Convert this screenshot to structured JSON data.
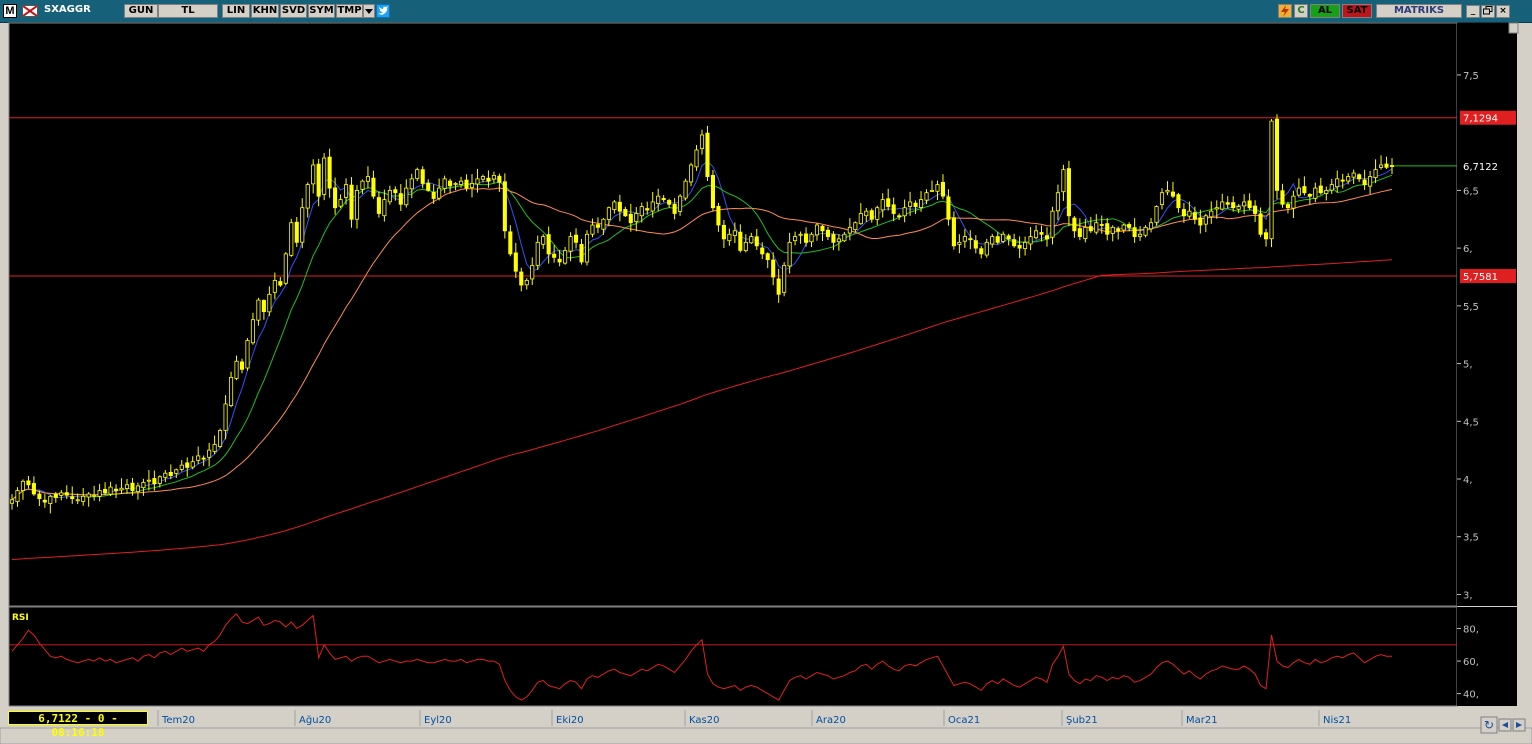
{
  "toolbar": {
    "symbol": "SXAGGR",
    "buttons": [
      "GUN",
      "TL",
      "LIN",
      "KHN",
      "SVD",
      "SYM",
      "TMP"
    ],
    "al_label": "AL",
    "sat_label": "SAT",
    "brand_label": "MATRIKS",
    "m_label": "M"
  },
  "readout": "6,7122 - 0 - 08:16:18",
  "colors": {
    "background": "#000000",
    "candle": "#ffff00",
    "ma_short": "#3050ff",
    "ma_mid": "#20c020",
    "ma_long": "#ff8a50",
    "ma_200": "#e02020",
    "hline": "#e02020",
    "rsi": "#e02020",
    "axis_text": "#c0c0c0",
    "time_text": "#00c8ff"
  },
  "chart_data": [
    {
      "type": "candlestick",
      "title": "",
      "y_ticks": [
        "7,5",
        "6,5",
        "6,",
        "5,5",
        "5,",
        "4,5",
        "4,",
        "3,5",
        "3,"
      ],
      "y_tick_values": [
        7.5,
        6.5,
        6.0,
        5.5,
        5.0,
        4.5,
        4.0,
        3.5,
        3.0
      ],
      "ylim": [
        2.9,
        7.95
      ],
      "x_labels": [
        "Tem20",
        "Ağu20",
        "Eyl20",
        "Eki20",
        "Kas20",
        "Ara20",
        "Oca21",
        "Şub21",
        "Mar21",
        "Nis21"
      ],
      "last_price_label": "6,7122",
      "last_price": 6.7122,
      "horizontal_lines": [
        {
          "label": "7,1294",
          "value": 7.1294
        },
        {
          "label": "5,7581",
          "value": 5.7581
        }
      ],
      "close": [
        3.82,
        3.9,
        3.98,
        3.95,
        3.87,
        3.83,
        3.8,
        3.85,
        3.84,
        3.88,
        3.86,
        3.83,
        3.82,
        3.85,
        3.87,
        3.86,
        3.9,
        3.88,
        3.93,
        3.9,
        3.92,
        3.95,
        3.9,
        3.94,
        3.97,
        3.99,
        3.96,
        4.02,
        4.05,
        4.03,
        4.08,
        4.12,
        4.1,
        4.15,
        4.2,
        4.18,
        4.25,
        4.3,
        4.42,
        4.65,
        4.88,
        5.02,
        4.95,
        5.2,
        5.38,
        5.55,
        5.45,
        5.6,
        5.72,
        5.68,
        5.95,
        6.22,
        6.05,
        6.35,
        6.55,
        6.72,
        6.45,
        6.78,
        6.52,
        6.35,
        6.42,
        6.55,
        6.25,
        6.5,
        6.58,
        6.62,
        6.45,
        6.3,
        6.42,
        6.5,
        6.48,
        6.38,
        6.52,
        6.6,
        6.68,
        6.56,
        6.5,
        6.43,
        6.52,
        6.6,
        6.54,
        6.56,
        6.58,
        6.52,
        6.56,
        6.6,
        6.62,
        6.58,
        6.63,
        6.57,
        6.15,
        5.95,
        5.8,
        5.68,
        5.72,
        5.85,
        6.05,
        6.1,
        5.95,
        5.92,
        5.88,
        5.98,
        6.1,
        6.05,
        5.88,
        6.12,
        6.2,
        6.18,
        6.25,
        6.35,
        6.4,
        6.32,
        6.28,
        6.22,
        6.3,
        6.36,
        6.33,
        6.4,
        6.45,
        6.42,
        6.38,
        6.3,
        6.45,
        6.58,
        6.72,
        6.85,
        6.98,
        6.62,
        6.35,
        6.2,
        6.08,
        6.12,
        6.15,
        5.98,
        6.05,
        6.1,
        6.02,
        5.95,
        5.9,
        5.75,
        5.6,
        5.85,
        6.05,
        6.1,
        6.12,
        6.05,
        6.12,
        6.2,
        6.15,
        6.1,
        6.05,
        6.08,
        6.12,
        6.18,
        6.22,
        6.3,
        6.32,
        6.25,
        6.35,
        6.42,
        6.36,
        6.3,
        6.28,
        6.35,
        6.4,
        6.36,
        6.42,
        6.48,
        6.5,
        6.55,
        6.45,
        6.25,
        6.02,
        6.05,
        6.1,
        6.08,
        6.0,
        5.95,
        6.05,
        6.1,
        6.05,
        6.12,
        6.08,
        6.02,
        6.0,
        6.05,
        6.1,
        6.15,
        6.12,
        6.08,
        6.32,
        6.48,
        6.68,
        6.28,
        6.15,
        6.1,
        6.18,
        6.15,
        6.22,
        6.2,
        6.12,
        6.18,
        6.15,
        6.2,
        6.18,
        6.1,
        6.12,
        6.18,
        6.22,
        6.36,
        6.48,
        6.5,
        6.45,
        6.35,
        6.28,
        6.32,
        6.25,
        6.2,
        6.28,
        6.32,
        6.35,
        6.4,
        6.38,
        6.35,
        6.36,
        6.4,
        6.35,
        6.3,
        6.12,
        6.08,
        7.1,
        6.5,
        6.38,
        6.35,
        6.45,
        6.52,
        6.48,
        6.45,
        6.52,
        6.48,
        6.5,
        6.55,
        6.6,
        6.58,
        6.62,
        6.65,
        6.6,
        6.55,
        6.62,
        6.68,
        6.72,
        6.7,
        6.71
      ],
      "rsi": {
        "label": "RSI",
        "y_ticks": [
          "80,",
          "60,",
          "40,"
        ],
        "y_tick_values": [
          80,
          60,
          40
        ],
        "ylim": [
          33,
          92
        ],
        "level": 70,
        "values": [
          66,
          70,
          74,
          79,
          76,
          71,
          67,
          63,
          62,
          63,
          61,
          60,
          59,
          60,
          61,
          60,
          62,
          60,
          61,
          59,
          60,
          61,
          62,
          60,
          63,
          64,
          62,
          65,
          66,
          64,
          66,
          68,
          66,
          67,
          68,
          66,
          70,
          72,
          76,
          82,
          86,
          89,
          84,
          83,
          85,
          87,
          82,
          83,
          85,
          84,
          81,
          84,
          80,
          82,
          85,
          88,
          62,
          70,
          65,
          61,
          62,
          63,
          60,
          62,
          63,
          63,
          61,
          59,
          60,
          61,
          60,
          59,
          60,
          60,
          61,
          60,
          59,
          59,
          60,
          61,
          60,
          60,
          61,
          59,
          60,
          61,
          61,
          60,
          60,
          58,
          48,
          42,
          38,
          36,
          38,
          42,
          47,
          48,
          45,
          44,
          43,
          46,
          48,
          47,
          43,
          49,
          51,
          50,
          52,
          54,
          55,
          53,
          52,
          51,
          53,
          55,
          54,
          56,
          58,
          57,
          55,
          53,
          57,
          61,
          66,
          70,
          73,
          52,
          46,
          44,
          43,
          44,
          45,
          42,
          44,
          45,
          44,
          42,
          40,
          38,
          36,
          42,
          48,
          50,
          51,
          49,
          51,
          53,
          52,
          51,
          49,
          50,
          51,
          53,
          54,
          57,
          58,
          55,
          58,
          60,
          57,
          55,
          54,
          57,
          58,
          57,
          59,
          61,
          62,
          63,
          57,
          51,
          45,
          46,
          47,
          46,
          44,
          42,
          46,
          48,
          46,
          49,
          47,
          45,
          44,
          46,
          48,
          50,
          49,
          47,
          58,
          63,
          69,
          52,
          48,
          46,
          49,
          48,
          51,
          50,
          48,
          50,
          49,
          51,
          50,
          47,
          48,
          50,
          52,
          56,
          59,
          60,
          58,
          55,
          52,
          54,
          51,
          49,
          52,
          54,
          55,
          57,
          56,
          55,
          55,
          57,
          55,
          52,
          45,
          43,
          76,
          60,
          57,
          56,
          59,
          61,
          59,
          58,
          61,
          59,
          60,
          62,
          63,
          62,
          64,
          65,
          62,
          59,
          61,
          63,
          64,
          63,
          63
        ]
      }
    }
  ]
}
